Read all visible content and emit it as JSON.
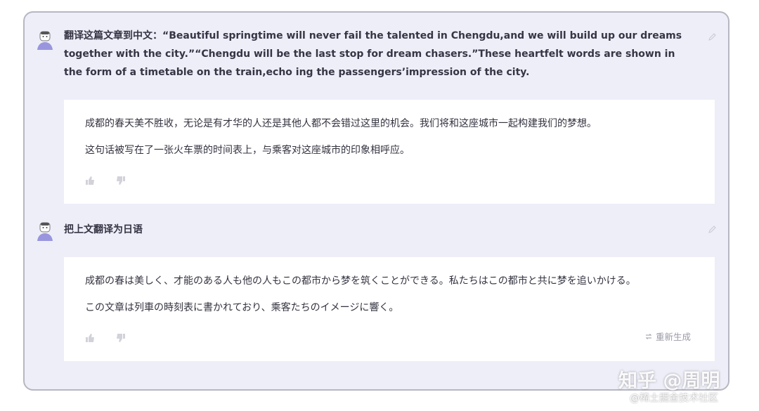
{
  "messages": [
    {
      "user_text": "翻译这篇文章到中文：“Beautiful springtime will never fail the talented in Chengdu,and we will build up our dreams together with the city.”“Chengdu will be the last stop for dream chasers.”These heartfelt words are shown in the form of a timetable on the train,echo ing the passengers’impression of the city.",
      "answer_paragraphs": [
        "成都的春天美不胜收，无论是有才华的人还是其他人都不会错过这里的机会。我们将和这座城市一起构建我们的梦想。",
        "这句话被写在了一张火车票的时间表上，与乘客对这座城市的印象相呼应。"
      ]
    },
    {
      "user_text": "把上文翻译为日语",
      "answer_paragraphs": [
        "成都の春は美しく、才能のある人も他の人もこの都市から梦を筑くことができる。私たちはこの都市と共に梦を追いかける。",
        "この文章は列車の時刻表に書かれており、乘客たちのイメージに響く。"
      ]
    }
  ],
  "regenerate_label": "重新生成",
  "watermark": {
    "line1": "知乎 @周明",
    "line2": "@稀土掘金技术社区"
  },
  "icons": {
    "avatar": "user-avatar-icon",
    "edit": "pencil-icon",
    "like": "thumbs-up-icon",
    "dislike": "thumbs-down-icon",
    "regenerate": "refresh-icon"
  },
  "colors": {
    "panel_bg": "#eeeef8",
    "answer_bg": "#ffffff",
    "text": "#353545",
    "muted": "#9a9aa6",
    "avatar_accent": "#9a96de"
  }
}
